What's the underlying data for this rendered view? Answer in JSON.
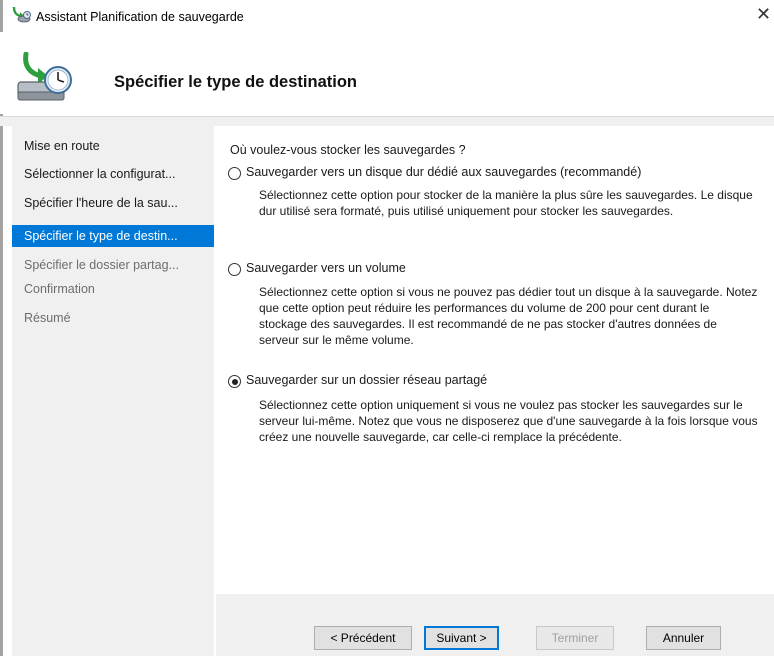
{
  "window": {
    "title": "Assistant Planification de sauvegarde",
    "close_glyph": "✕",
    "app_icon": "backup-wizard-icon"
  },
  "header": {
    "title": "Spécifier le type de destination",
    "icon": "backup-disk-clock-icon"
  },
  "nav": {
    "items": [
      {
        "label": "Mise en route",
        "state": "done"
      },
      {
        "label": "Sélectionner la configurat...",
        "state": "done"
      },
      {
        "label": "Spécifier l'heure de la sau...",
        "state": "done"
      },
      {
        "label": "Spécifier le type de destin...",
        "state": "active"
      },
      {
        "label": "Spécifier le dossier partag...",
        "state": "pending"
      },
      {
        "label": "Confirmation",
        "state": "pending"
      },
      {
        "label": "Résumé",
        "state": "pending"
      }
    ]
  },
  "content": {
    "question": "Où voulez-vous stocker les sauvegardes ?",
    "options": [
      {
        "label": "Sauvegarder vers un disque dur dédié aux sauvegardes (recommandé)",
        "description": "Sélectionnez cette option pour stocker de la manière la plus sûre les sauvegardes. Le disque dur utilisé sera formaté, puis utilisé uniquement pour stocker les sauvegardes.",
        "selected": false
      },
      {
        "label": "Sauvegarder vers un volume",
        "description": "Sélectionnez cette option si vous ne pouvez pas dédier tout un disque à la sauvegarde. Notez que cette option peut réduire les performances du volume de 200 pour cent durant le stockage des sauvegardes. Il est recommandé de ne pas stocker d'autres données de serveur sur le même volume.",
        "selected": false
      },
      {
        "label": "Sauvegarder sur un dossier réseau partagé",
        "description": "Sélectionnez cette option uniquement si vous ne voulez pas stocker les sauvegardes sur le serveur lui-même. Notez que vous ne disposerez que d'une sauvegarde à la fois lorsque vous créez une nouvelle sauvegarde, car celle-ci remplace la précédente.",
        "selected": true
      }
    ]
  },
  "buttons": {
    "previous": "< Précédent",
    "next": "Suivant >",
    "finish": "Terminer",
    "cancel": "Annuler"
  },
  "colors": {
    "accent": "#0078d7",
    "nav_background": "#f0f0f0"
  }
}
